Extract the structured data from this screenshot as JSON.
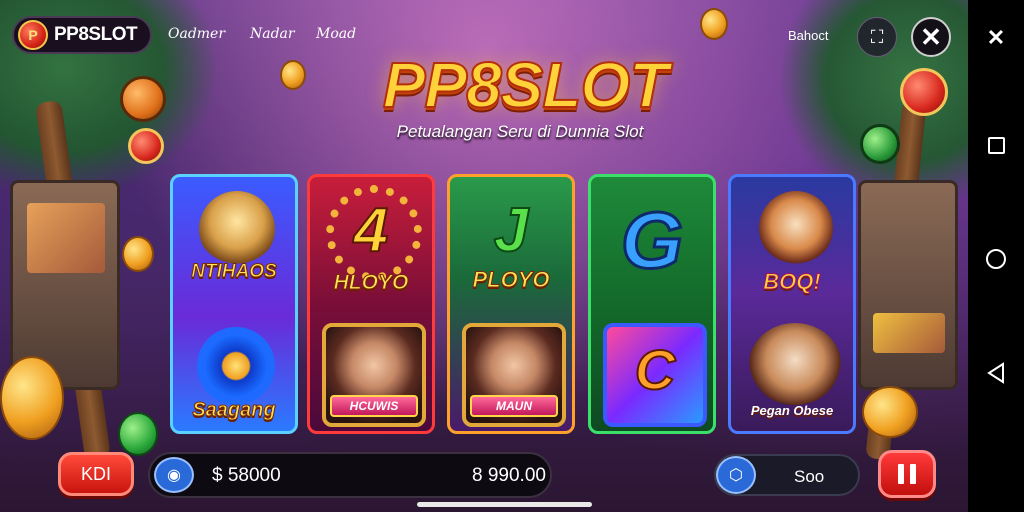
{
  "app": {
    "logo_badge": "P",
    "logo_text": "PP8SLOT"
  },
  "top_nav": {
    "links": [
      "Oadmer",
      "Nadar",
      "Moad"
    ],
    "right_label": "Bahoct"
  },
  "icons": {
    "expand": "expand-icon",
    "close": "close-icon",
    "tools": "tools-icon",
    "camera": "camera-icon",
    "shield": "shield-icon",
    "pause": "pause-icon"
  },
  "hero": {
    "title": "PP8SLOT",
    "subtitle": "Petualangan Seru di Dunnia Slot"
  },
  "games": [
    {
      "top_label": "NTIHAOS",
      "bottom_label": "Saagang"
    },
    {
      "big_glyph": "4",
      "top_label": "HLOYO",
      "bottom_label": "HCUWIS"
    },
    {
      "big_glyph": "J",
      "top_label": "PLOYO",
      "bottom_label": "MAUN"
    },
    {
      "big_glyph": "G",
      "bottom_label": "C"
    },
    {
      "top_label": "BOQ!",
      "bottom_label": "Pegan Obese"
    }
  ],
  "bottom_bar": {
    "left_button": "KDI",
    "balance_left": "$ 58000",
    "balance_right": "8 990.00",
    "action_label": "Soo"
  },
  "colors": {
    "accent_gold": "#ffd23a",
    "accent_red": "#d42418",
    "accent_blue": "#2a6ad8"
  }
}
